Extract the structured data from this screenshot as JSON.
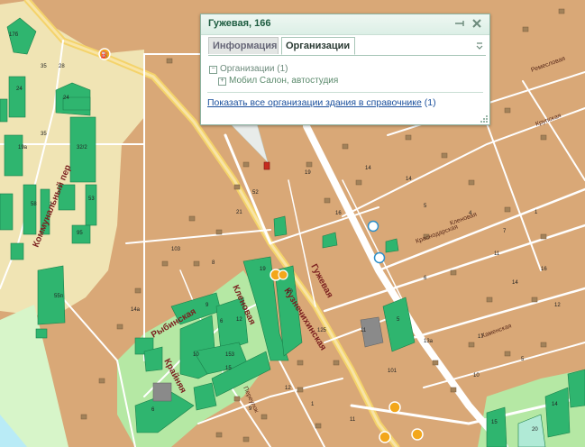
{
  "popup": {
    "title": "Гужевая, 166",
    "tabs": [
      {
        "label": "Информация",
        "active": false
      },
      {
        "label": "Организации",
        "active": true
      }
    ],
    "tree": {
      "group_label": "Организации (1)",
      "group_toggle": "−",
      "item_label": "Мобил Салон, автостудия",
      "item_toggle": "+"
    },
    "show_all_link": "Показать все организации здания в справочнике",
    "show_all_count": "(1)",
    "icons": [
      "pin-icon",
      "close-icon",
      "tabs-menu-icon",
      "resize-grip-icon"
    ]
  },
  "map": {
    "streets": [
      "Коммунальный пер",
      "Рыбинская",
      "Кленовая",
      "Крайняя",
      "Кузнечихинская",
      "Гужевая",
      "Переулок",
      "Краснодарская",
      "Кленовая",
      "Ремесловая",
      "Крупская",
      "Каменская"
    ],
    "building_numbers": [
      "17б",
      "24",
      "24",
      "35",
      "19а",
      "32/2",
      "58",
      "1",
      "53",
      "95",
      "55п",
      "28",
      "35",
      "19",
      "10",
      "9",
      "12",
      "10",
      "153",
      "14а",
      "15",
      "6",
      "5",
      "125",
      "11",
      "101",
      "13а",
      "10",
      "5",
      "14",
      "20",
      "15",
      "16",
      "12",
      "14",
      "11",
      "7",
      "1",
      "4",
      "5",
      "14",
      "14",
      "16",
      "19",
      "52",
      "21",
      "103",
      "8",
      "6",
      "9",
      "12",
      "1",
      "11",
      "17",
      "6"
    ],
    "colors": {
      "ground": "#d9a877",
      "park": "#f0e4b4",
      "lightgreen": "#b5e8a4",
      "building": "#2fb56f",
      "road": "#ffffff",
      "main_road": "#f4d36b",
      "water": "#b9ebf6",
      "street_label": "#7a1f1f"
    },
    "markers": [
      "fuel-station-icon",
      "bus-stop-icon"
    ]
  }
}
